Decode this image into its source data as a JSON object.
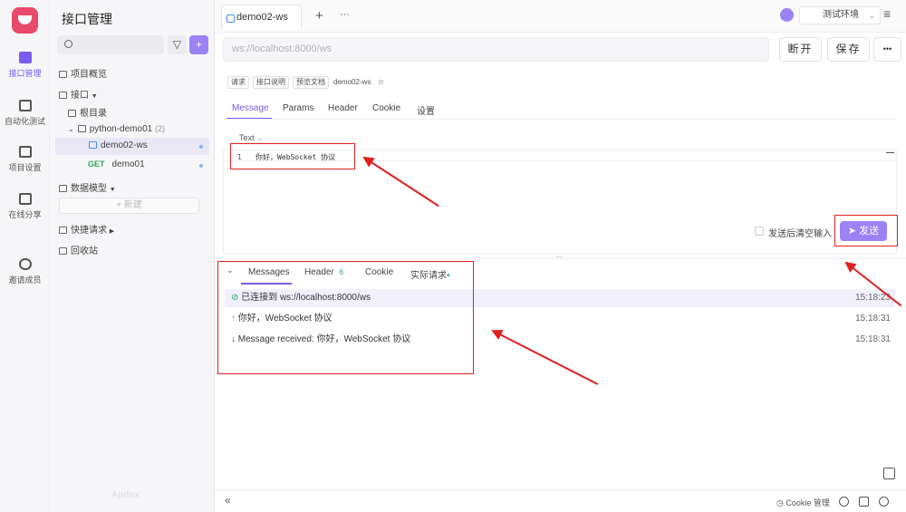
{
  "rail": {
    "items": [
      {
        "label": "接口管理",
        "icon": "api-icon",
        "active": true
      },
      {
        "label": "自动化测试",
        "icon": "automation-icon"
      },
      {
        "label": "项目设置",
        "icon": "settings-icon"
      },
      {
        "label": "在线分享",
        "icon": "share-icon"
      },
      {
        "label": "邀请成员",
        "icon": "invite-icon"
      }
    ]
  },
  "sidebar": {
    "title": "接口管理",
    "overview": "项目概览",
    "api_root": "接口",
    "root_dir": "根目录",
    "folder": "python-demo01",
    "folder_count": "(2)",
    "items": [
      {
        "method": "",
        "label": "demo02-ws"
      },
      {
        "method": "GET",
        "label": "demo01"
      }
    ],
    "data_model": "数据模型",
    "new_button": "+ 新建",
    "quick_request": "快捷请求",
    "recycle_bin": "回收站",
    "footer_watermark": "Apifox"
  },
  "tabs": {
    "active_tab": "demo02-ws",
    "add": "+",
    "more": "···"
  },
  "env": {
    "label": "测试环境",
    "menu": "≡"
  },
  "url_bar": {
    "value": "ws://localhost:8000/ws",
    "disconnect": "断开",
    "save": "保存",
    "more": "•••"
  },
  "crumbs": {
    "request": "请求",
    "api_doc": "接口说明",
    "preview_doc": "预览文档",
    "name": "demo02-ws"
  },
  "subtabs": [
    "Message",
    "Params",
    "Header",
    "Cookie",
    "设置"
  ],
  "editor": {
    "format": "Text",
    "line_no": "1",
    "content": "你好，WebSocket 协议",
    "clear_after_send": "发送后清空输入",
    "send": "发送"
  },
  "panel": {
    "tabs": [
      {
        "label": "Messages",
        "badge": ""
      },
      {
        "label": "Header",
        "badge": "6"
      },
      {
        "label": "Cookie",
        "badge": ""
      },
      {
        "label": "实际请求",
        "badge": "•"
      }
    ],
    "messages": [
      {
        "icon": "check-circle-icon",
        "text": "已连接到 ws://localhost:8000/ws",
        "time": "15:18:23"
      },
      {
        "icon": "arrow-up-icon",
        "text": "你好，WebSocket 协议",
        "time": "15:18:31"
      },
      {
        "icon": "arrow-down-icon",
        "text": "Message received: 你好，WebSocket 协议",
        "time": "15:18:31"
      }
    ]
  },
  "footer": {
    "collapse": "«",
    "cookie_manage": "Cookie 管理"
  },
  "colors": {
    "accent": "#7a5cf0",
    "annotation": "#e02020"
  }
}
